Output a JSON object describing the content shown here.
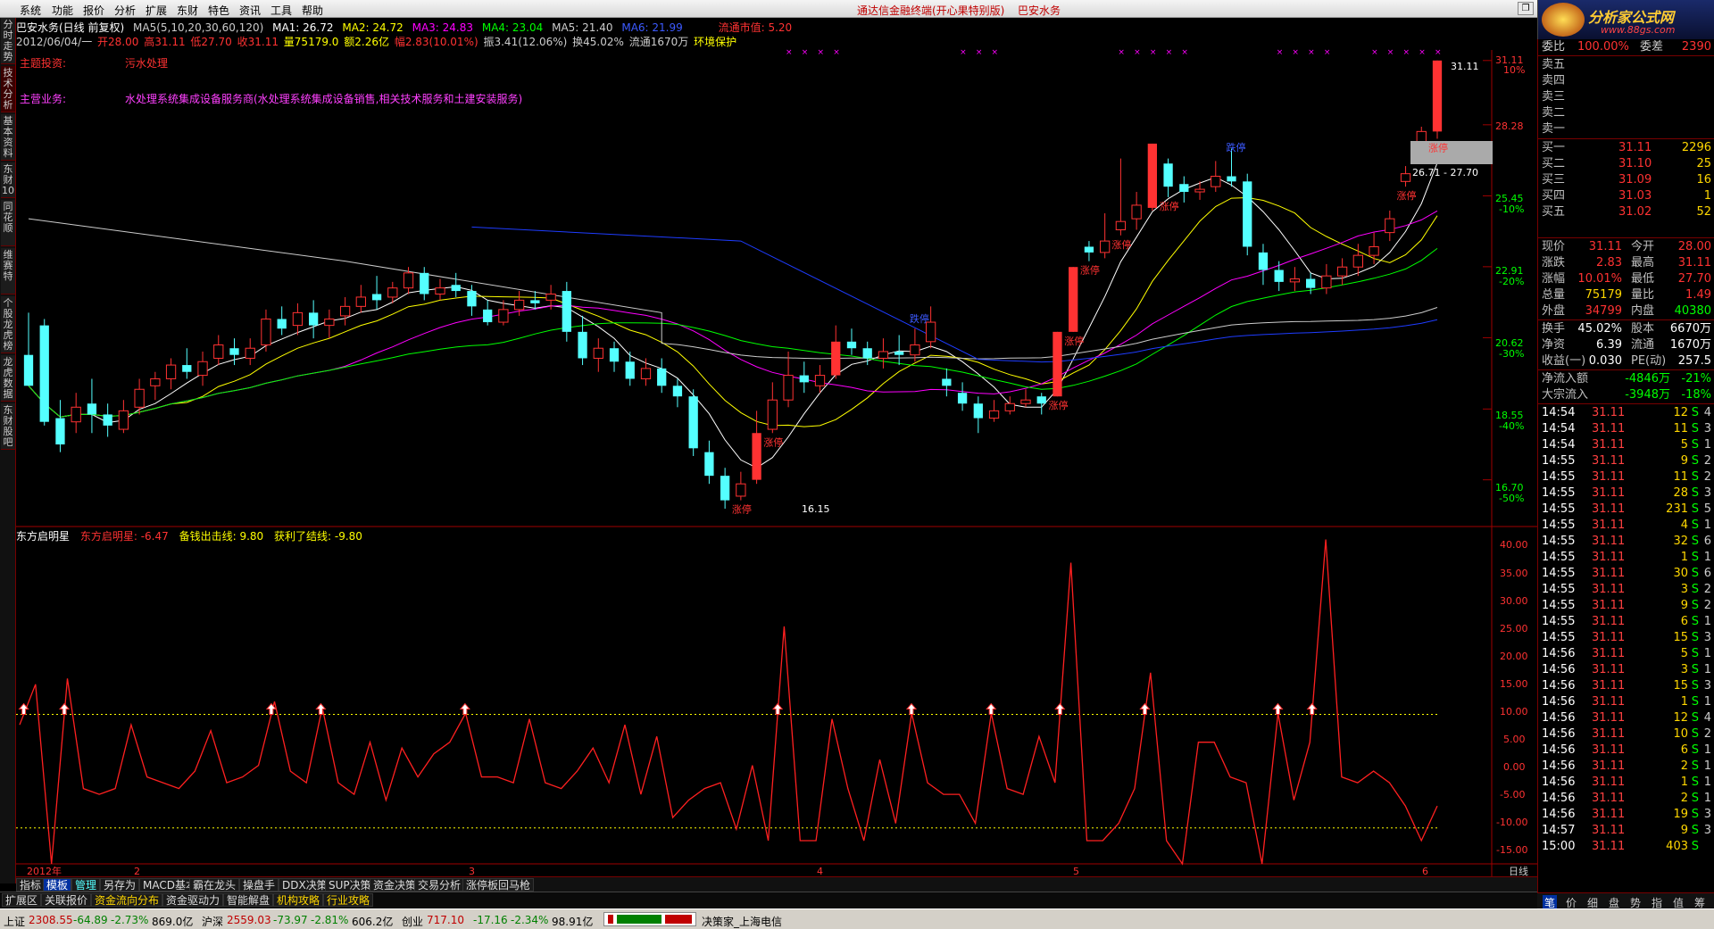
{
  "menu": {
    "items": [
      "系统",
      "功能",
      "报价",
      "分析",
      "扩展",
      "东财",
      "特色",
      "资讯",
      "工具",
      "帮助"
    ],
    "title": "通达信金融终端(开心果特别版)",
    "stock_name": "巴安水务"
  },
  "logo": {
    "text": "分析家公式网",
    "url": "www.88gs.com"
  },
  "left_tabs": [
    "分时走势",
    "技术分析",
    "基本资料",
    "东财10",
    "同花顺",
    "维赛特",
    "个股龙虎榜",
    "龙虎数据",
    "东财股吧"
  ],
  "header1": {
    "stock": "巴安水务(日线 前复权)",
    "ma_params": "MA5(5,10,20,30,60,120)",
    "ma1": "MA1: 26.72",
    "ma2": "MA2: 24.72",
    "ma3": "MA3: 24.83",
    "ma4": "MA4: 23.04",
    "ma5": "MA5: 21.40",
    "ma6": "MA6: 21.99",
    "mktcap": "流通市值: 5.20"
  },
  "header2": {
    "date": "2012/06/04/一",
    "open": "开28.00",
    "high": "高31.11",
    "low": "低27.70",
    "close": "收31.11",
    "vol": "量75179.0",
    "amount": "额2.26亿",
    "chg": "幅2.83(10.01%)",
    "amp": "振3.41(12.06%)",
    "turnover": "换45.02%",
    "float": "流通1670万",
    "env": "环境保护"
  },
  "annotations": {
    "topic_label": "主题投资:",
    "topic_value": "污水处理",
    "biz_label": "主营业务:",
    "biz_value": "水处理系统集成设备服务商(水处理系统集成设备销售,相关技术服务和土建安装服务)"
  },
  "price_axis": [
    {
      "v": "31.11",
      "p": "10%"
    },
    {
      "v": "28.28",
      "p": ""
    },
    {
      "v": "25.45",
      "p": "-10%"
    },
    {
      "v": "22.91",
      "p": "-20%"
    },
    {
      "v": "20.62",
      "p": "-30%"
    },
    {
      "v": "18.55",
      "p": "-40%"
    },
    {
      "v": "16.70",
      "p": "-50%"
    }
  ],
  "price_labels": {
    "high": "31.11",
    "low": "16.15",
    "range": "26.71 - 27.70"
  },
  "limit_up": "涨停",
  "limit_down": "跌停",
  "indicator": {
    "name": "东方启明星",
    "value_label": "东方启明星: -6.47",
    "buy_label": "备钱出击线: 9.80",
    "sell_label": "获利了结线: -9.80"
  },
  "ind_axis": [
    "40.00",
    "35.00",
    "30.00",
    "25.00",
    "20.00",
    "15.00",
    "10.00",
    "5.00",
    "0.00",
    "-5.00",
    "-10.00",
    "-15.00"
  ],
  "time_axis": {
    "year": "2012年",
    "m2": "2",
    "m3": "3",
    "m4": "4",
    "m5": "5",
    "m6": "6",
    "period": "日线"
  },
  "bottom_tabs1": [
    "指标",
    "模板",
    "管理",
    "另存为",
    "MACD基本",
    "霸在龙头",
    "操盘手",
    "DDX决策",
    "SUP决策",
    "资金决策",
    "交易分析",
    "涨停板回马枪"
  ],
  "bottom_tabs2": [
    "扩展区",
    "关联报价",
    "资金流向分布",
    "资金驱动力",
    "智能解盘",
    "机构攻略",
    "行业攻略"
  ],
  "status": {
    "sh_label": "上证",
    "sh_val": "2308.55",
    "sh_chg": "-64.89",
    "sh_pct": "-2.73%",
    "sh_amt": "869.0亿",
    "hs_label": "沪深",
    "hs_val": "2559.03",
    "hs_chg": "-73.97",
    "hs_pct": "-2.81%",
    "hs_amt": "606.2亿",
    "cy_label": "创业",
    "cy_val": "717.10",
    "cy_chg": "-17.16",
    "cy_pct": "-2.34%",
    "cy_amt": "98.91亿",
    "broker": "决策家_上海电信"
  },
  "quote": {
    "weibi": {
      "l": "委比",
      "v": "100.00%",
      "l2": "委差",
      "v2": "2390"
    },
    "sells": [
      {
        "l": "卖五"
      },
      {
        "l": "卖四"
      },
      {
        "l": "卖三"
      },
      {
        "l": "卖二"
      },
      {
        "l": "卖一"
      }
    ],
    "buys": [
      {
        "l": "买一",
        "p": "31.11",
        "q": "2296"
      },
      {
        "l": "买二",
        "p": "31.10",
        "q": "25"
      },
      {
        "l": "买三",
        "p": "31.09",
        "q": "16"
      },
      {
        "l": "买四",
        "p": "31.03",
        "q": "1"
      },
      {
        "l": "买五",
        "p": "31.02",
        "q": "52"
      }
    ],
    "stats": [
      {
        "l": "现价",
        "v": "31.11",
        "l2": "今开",
        "v2": "28.00"
      },
      {
        "l": "涨跌",
        "v": "2.83",
        "l2": "最高",
        "v2": "31.11"
      },
      {
        "l": "涨幅",
        "v": "10.01%",
        "l2": "最低",
        "v2": "27.70"
      },
      {
        "l": "总量",
        "v": "75179",
        "l2": "量比",
        "v2": "1.49"
      },
      {
        "l": "外盘",
        "v": "34799",
        "l2": "内盘",
        "v2": "40380"
      }
    ],
    "fin": [
      {
        "l": "换手",
        "v": "45.02%",
        "l2": "股本",
        "v2": "6670万"
      },
      {
        "l": "净资",
        "v": "6.39",
        "l2": "流通",
        "v2": "1670万"
      },
      {
        "l": "收益(一)",
        "v": "0.030",
        "l2": "PE(动)",
        "v2": "257.5"
      }
    ],
    "flows": [
      {
        "l": "净流入额",
        "v": "-4846万",
        "p": "-21%"
      },
      {
        "l": "大宗流入",
        "v": "-3948万",
        "p": "-18%"
      }
    ],
    "ticks": [
      {
        "t": "14:54",
        "p": "31.11",
        "q": "12",
        "s": "S",
        "n": "4"
      },
      {
        "t": "14:54",
        "p": "31.11",
        "q": "11",
        "s": "S",
        "n": "3"
      },
      {
        "t": "14:54",
        "p": "31.11",
        "q": "5",
        "s": "S",
        "n": "1"
      },
      {
        "t": "14:55",
        "p": "31.11",
        "q": "9",
        "s": "S",
        "n": "2"
      },
      {
        "t": "14:55",
        "p": "31.11",
        "q": "11",
        "s": "S",
        "n": "2"
      },
      {
        "t": "14:55",
        "p": "31.11",
        "q": "28",
        "s": "S",
        "n": "3"
      },
      {
        "t": "14:55",
        "p": "31.11",
        "q": "231",
        "s": "S",
        "n": "5"
      },
      {
        "t": "14:55",
        "p": "31.11",
        "q": "4",
        "s": "S",
        "n": "1"
      },
      {
        "t": "14:55",
        "p": "31.11",
        "q": "32",
        "s": "S",
        "n": "6"
      },
      {
        "t": "14:55",
        "p": "31.11",
        "q": "1",
        "s": "S",
        "n": "1"
      },
      {
        "t": "14:55",
        "p": "31.11",
        "q": "30",
        "s": "S",
        "n": "6"
      },
      {
        "t": "14:55",
        "p": "31.11",
        "q": "3",
        "s": "S",
        "n": "2"
      },
      {
        "t": "14:55",
        "p": "31.11",
        "q": "9",
        "s": "S",
        "n": "2"
      },
      {
        "t": "14:55",
        "p": "31.11",
        "q": "6",
        "s": "S",
        "n": "1"
      },
      {
        "t": "14:55",
        "p": "31.11",
        "q": "15",
        "s": "S",
        "n": "3"
      },
      {
        "t": "14:56",
        "p": "31.11",
        "q": "5",
        "s": "S",
        "n": "1"
      },
      {
        "t": "14:56",
        "p": "31.11",
        "q": "3",
        "s": "S",
        "n": "1"
      },
      {
        "t": "14:56",
        "p": "31.11",
        "q": "15",
        "s": "S",
        "n": "3"
      },
      {
        "t": "14:56",
        "p": "31.11",
        "q": "1",
        "s": "S",
        "n": "1"
      },
      {
        "t": "14:56",
        "p": "31.11",
        "q": "12",
        "s": "S",
        "n": "4"
      },
      {
        "t": "14:56",
        "p": "31.11",
        "q": "10",
        "s": "S",
        "n": "2"
      },
      {
        "t": "14:56",
        "p": "31.11",
        "q": "6",
        "s": "S",
        "n": "1"
      },
      {
        "t": "14:56",
        "p": "31.11",
        "q": "2",
        "s": "S",
        "n": "1"
      },
      {
        "t": "14:56",
        "p": "31.11",
        "q": "1",
        "s": "S",
        "n": "1"
      },
      {
        "t": "14:56",
        "p": "31.11",
        "q": "2",
        "s": "S",
        "n": "1"
      },
      {
        "t": "14:56",
        "p": "31.11",
        "q": "19",
        "s": "S",
        "n": "3"
      },
      {
        "t": "14:57",
        "p": "31.11",
        "q": "9",
        "s": "S",
        "n": "3"
      },
      {
        "t": "15:00",
        "p": "31.11",
        "q": "403",
        "s": "S",
        "n": ""
      }
    ]
  },
  "right_tabs": [
    "笔",
    "价",
    "细",
    "盘",
    "势",
    "指",
    "值",
    "筹"
  ],
  "colors": {
    "up": "#ff3232",
    "down": "#54ffff",
    "ma1": "#ffffff",
    "ma2": "#ffff00",
    "ma3": "#ff00ff",
    "ma4": "#00ff00",
    "ma5": "#1e3cff",
    "ma6": "#cccccc"
  },
  "chart_data": {
    "type": "candlestick",
    "price_range": [
      16.15,
      31.11
    ],
    "candles": [
      [
        20.1,
        19.2,
        21.4,
        20.0
      ],
      [
        21.0,
        18.2,
        21.2,
        18.1
      ],
      [
        18.3,
        17.6,
        18.8,
        17.4
      ],
      [
        18.2,
        18.6,
        19.0,
        17.9
      ],
      [
        18.7,
        18.4,
        19.4,
        17.9
      ],
      [
        18.4,
        18.1,
        18.7,
        17.8
      ],
      [
        18.0,
        18.5,
        18.8,
        17.9
      ],
      [
        18.6,
        19.1,
        19.4,
        18.4
      ],
      [
        19.2,
        19.4,
        19.6,
        18.8
      ],
      [
        19.4,
        19.8,
        20.0,
        19.1
      ],
      [
        19.8,
        19.6,
        20.3,
        19.4
      ],
      [
        19.5,
        19.9,
        20.2,
        19.2
      ],
      [
        20.0,
        20.4,
        20.7,
        19.8
      ],
      [
        20.3,
        20.1,
        20.6,
        19.8
      ],
      [
        20.0,
        20.3,
        20.6,
        19.8
      ],
      [
        20.4,
        21.2,
        21.5,
        20.2
      ],
      [
        21.2,
        20.9,
        21.6,
        20.7
      ],
      [
        21.0,
        21.4,
        21.7,
        20.7
      ],
      [
        21.4,
        21.0,
        21.8,
        20.6
      ],
      [
        21.0,
        21.2,
        21.5,
        20.6
      ],
      [
        21.3,
        21.6,
        21.9,
        21.0
      ],
      [
        21.6,
        21.9,
        22.3,
        21.4
      ],
      [
        22.0,
        21.8,
        22.6,
        21.5
      ],
      [
        21.9,
        22.2,
        22.4,
        21.7
      ],
      [
        22.2,
        22.7,
        22.9,
        22.0
      ],
      [
        22.7,
        22.0,
        22.9,
        21.8
      ],
      [
        22.0,
        22.2,
        22.5,
        21.8
      ],
      [
        22.3,
        22.1,
        22.7,
        21.9
      ],
      [
        22.1,
        21.6,
        22.3,
        21.3
      ],
      [
        21.5,
        21.1,
        21.8,
        21.0
      ],
      [
        21.1,
        21.5,
        21.8,
        21.0
      ],
      [
        21.5,
        21.8,
        22.1,
        21.3
      ],
      [
        21.8,
        21.7,
        22.1,
        21.5
      ],
      [
        21.8,
        22.0,
        22.3,
        21.5
      ],
      [
        22.1,
        20.8,
        22.4,
        20.5
      ],
      [
        20.8,
        20.0,
        21.3,
        19.8
      ],
      [
        20.0,
        20.3,
        20.6,
        19.6
      ],
      [
        20.3,
        19.9,
        20.5,
        19.6
      ],
      [
        19.9,
        19.4,
        20.2,
        19.2
      ],
      [
        19.4,
        19.7,
        20.0,
        19.2
      ],
      [
        19.7,
        19.2,
        20.0,
        19.0
      ],
      [
        19.2,
        18.9,
        19.4,
        18.6
      ],
      [
        18.9,
        17.5,
        19.1,
        17.3
      ],
      [
        17.4,
        16.8,
        17.7,
        16.6
      ],
      [
        16.8,
        16.2,
        17.0,
        16.0
      ],
      [
        16.3,
        16.6,
        16.9,
        16.2
      ],
      [
        16.7,
        17.9,
        18.5,
        16.6
      ],
      [
        18.0,
        18.8,
        19.3,
        17.9
      ],
      [
        18.8,
        19.5,
        20.2,
        18.6
      ],
      [
        19.5,
        19.3,
        19.9,
        19.0
      ],
      [
        19.2,
        19.5,
        19.8,
        19.0
      ],
      [
        19.5,
        20.5,
        21.0,
        19.4
      ],
      [
        20.5,
        20.3,
        20.9,
        20.1
      ],
      [
        20.3,
        20.0,
        20.5,
        19.8
      ],
      [
        20.0,
        20.2,
        20.6,
        19.7
      ],
      [
        20.2,
        20.1,
        20.7,
        19.8
      ],
      [
        20.1,
        20.4,
        20.9,
        19.9
      ],
      [
        20.5,
        21.1,
        21.6,
        20.3
      ],
      [
        19.4,
        19.2,
        19.7,
        18.9
      ],
      [
        19.0,
        18.7,
        19.3,
        18.5
      ],
      [
        18.7,
        18.3,
        18.9,
        17.9
      ],
      [
        18.3,
        18.5,
        18.8,
        18.2
      ],
      [
        18.5,
        18.7,
        18.9,
        18.4
      ],
      [
        18.7,
        18.8,
        19.1,
        18.6
      ],
      [
        18.9,
        18.7,
        19.0,
        18.4
      ],
      [
        18.9,
        20.8,
        20.8,
        18.9
      ],
      [
        20.8,
        22.9,
        22.9,
        20.8
      ],
      [
        23.6,
        23.4,
        23.8,
        23.1
      ],
      [
        23.4,
        23.8,
        24.8,
        23.2
      ],
      [
        24.2,
        24.5,
        26.9,
        24.0
      ],
      [
        24.6,
        25.1,
        25.6,
        24.2
      ],
      [
        25.0,
        27.5,
        27.5,
        24.9
      ],
      [
        26.7,
        25.8,
        26.9,
        25.4
      ],
      [
        25.9,
        25.6,
        26.2,
        25.2
      ],
      [
        25.6,
        25.7,
        26.0,
        25.3
      ],
      [
        25.8,
        26.2,
        26.8,
        25.6
      ],
      [
        26.2,
        26.0,
        27.3,
        25.8
      ],
      [
        26.0,
        23.6,
        26.3,
        23.3
      ],
      [
        23.4,
        22.8,
        23.7,
        22.3
      ],
      [
        22.8,
        22.4,
        23.1,
        22.1
      ],
      [
        22.4,
        22.5,
        22.9,
        22.1
      ],
      [
        22.5,
        22.2,
        22.7,
        22.0
      ],
      [
        22.2,
        22.6,
        23.0,
        22.0
      ],
      [
        22.6,
        22.9,
        23.2,
        22.3
      ],
      [
        22.9,
        23.3,
        23.7,
        22.6
      ],
      [
        23.3,
        23.6,
        24.1,
        23.0
      ],
      [
        24.1,
        24.6,
        24.9,
        23.8
      ],
      [
        26.0,
        26.3,
        26.6,
        25.8
      ],
      [
        27.2,
        28.0,
        28.2,
        26.9
      ],
      [
        28.0,
        31.11,
        31.11,
        27.7
      ]
    ],
    "ind_values": [
      8,
      15,
      -16,
      16,
      -3,
      -4,
      -3,
      8,
      -1,
      -2,
      -3,
      0,
      7,
      -2,
      -1,
      1,
      12,
      0,
      -2,
      11,
      -2,
      -4,
      5,
      -5,
      4,
      -1,
      3,
      5,
      10,
      -1,
      -1,
      -2,
      9,
      -2,
      -3,
      0,
      4,
      -2,
      8,
      -4,
      6,
      -8,
      -5,
      -3,
      -2,
      -10,
      1,
      -12,
      25,
      -12,
      -12,
      9,
      -3,
      -12,
      2,
      -9,
      10,
      -2,
      -4,
      -4,
      -9,
      10,
      -3,
      -4,
      6,
      -2,
      36,
      -12,
      -12,
      -9,
      -3,
      17,
      -12,
      -16,
      5,
      5,
      -1,
      -2,
      -16,
      10,
      -5,
      5,
      40,
      -1,
      -2,
      0,
      -2,
      -6,
      -12,
      -6
    ],
    "buy_line": 9.8,
    "sell_line": -9.8,
    "ind_range": [
      -16,
      41
    ]
  }
}
